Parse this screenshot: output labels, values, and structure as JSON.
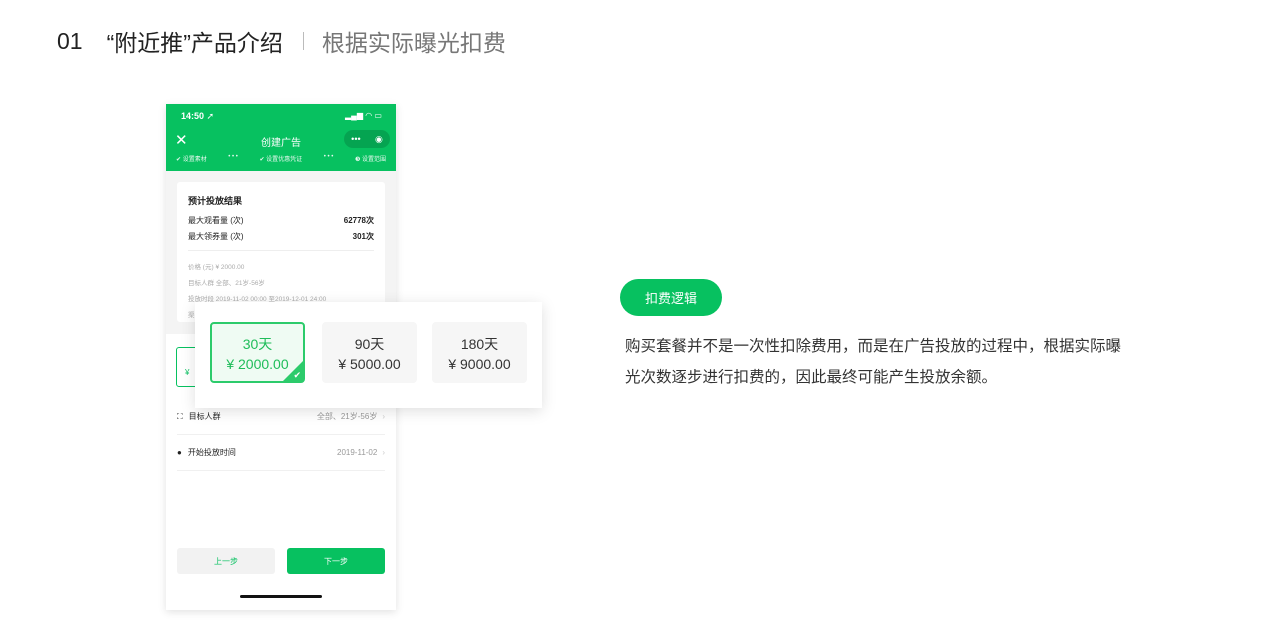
{
  "header": {
    "number": "01",
    "title": "“附近推”产品介绍",
    "subtitle": "根据实际曝光扣费"
  },
  "phone": {
    "status_time": "14:50 ➚",
    "status_icons": "▂▄▆ ◠ ▭",
    "nav_title": "创建广告",
    "capsule_more": "•••",
    "capsule_target": "◉",
    "steps": [
      "✔ 设置素材",
      "• • •",
      "✔ 设置优惠凭证",
      "• • •",
      "❸ 设置范围"
    ],
    "card": {
      "title": "预计投放结果",
      "rows": [
        {
          "label": "最大观看量 (次)",
          "value": "62778次"
        },
        {
          "label": "最大领券量 (次)",
          "value": "301次"
        }
      ],
      "meta": [
        "价格 (元)   ¥ 2000.00",
        "目标人群   全部、21岁-56岁",
        "投放时段   2019-11-02 00:00 至2019-12-01 24:00",
        "渠"
      ]
    },
    "hidden_price": "¥",
    "list": [
      {
        "icon": "⛶",
        "label": "目标人群",
        "value": "全部、21岁-56岁"
      },
      {
        "icon": "●",
        "label": "开始投放时间",
        "value": "2019-11-02"
      }
    ],
    "chevron": "›",
    "prev_button": "上一步",
    "next_button": "下一步"
  },
  "packages": [
    {
      "days": "30天",
      "price": "¥ 2000.00",
      "selected": true
    },
    {
      "days": "90天",
      "price": "¥ 5000.00",
      "selected": false
    },
    {
      "days": "180天",
      "price": "¥ 9000.00",
      "selected": false
    }
  ],
  "check": "✔",
  "pill": "扣费逻辑",
  "description": "购买套餐并不是一次性扣除费用，而是在广告投放的过程中，根据实际曝光次数逐步进行扣费的，因此最终可能产生投放余额。",
  "colors": {
    "brand": "#07c160"
  }
}
